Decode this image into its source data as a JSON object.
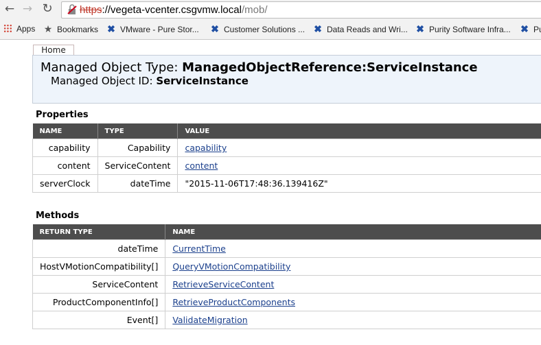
{
  "browser": {
    "url_scheme": "https",
    "url_host": "://vegeta-vcenter.csgvmw.local",
    "url_path": "/mob/",
    "bookmarks": [
      {
        "label": "Apps",
        "icon": "apps-grid-icon"
      },
      {
        "label": "Bookmarks",
        "icon": "star-icon"
      },
      {
        "label": "VMware - Pure Stor...",
        "icon": "x-logo-icon"
      },
      {
        "label": "Customer Solutions ...",
        "icon": "x-logo-icon"
      },
      {
        "label": "Data Reads and Wri...",
        "icon": "x-logo-icon"
      },
      {
        "label": "Purity Software Infra...",
        "icon": "x-logo-icon"
      },
      {
        "label": "Pu",
        "icon": "x-logo-icon"
      }
    ]
  },
  "page": {
    "home_tab": "Home",
    "mo_type_label": "Managed Object Type:",
    "mo_type_value": "ManagedObjectReference:ServiceInstance",
    "mo_id_label": "Managed Object ID:",
    "mo_id_value": "ServiceInstance"
  },
  "properties": {
    "title": "Properties",
    "headers": [
      "NAME",
      "TYPE",
      "VALUE"
    ],
    "rows": [
      {
        "name": "capability",
        "type": "Capability",
        "value": "capability",
        "link": true
      },
      {
        "name": "content",
        "type": "ServiceContent",
        "value": "content",
        "link": true
      },
      {
        "name": "serverClock",
        "type": "dateTime",
        "value": "\"2015-11-06T17:48:36.139416Z\"",
        "link": false
      }
    ]
  },
  "methods": {
    "title": "Methods",
    "headers": [
      "RETURN TYPE",
      "NAME"
    ],
    "rows": [
      {
        "return_type": "dateTime",
        "name": "CurrentTime"
      },
      {
        "return_type": "HostVMotionCompatibility[]",
        "name": "QueryVMotionCompatibility"
      },
      {
        "return_type": "ServiceContent",
        "name": "RetrieveServiceContent"
      },
      {
        "return_type": "ProductComponentInfo[]",
        "name": "RetrieveProductComponents"
      },
      {
        "return_type": "Event[]",
        "name": "ValidateMigration"
      }
    ]
  },
  "colors": {
    "table_header_bg": "#4d4d4d",
    "link": "#1a3f8c",
    "header_box_bg": "#eef4fb",
    "insecure_scheme": "#c0392b"
  }
}
